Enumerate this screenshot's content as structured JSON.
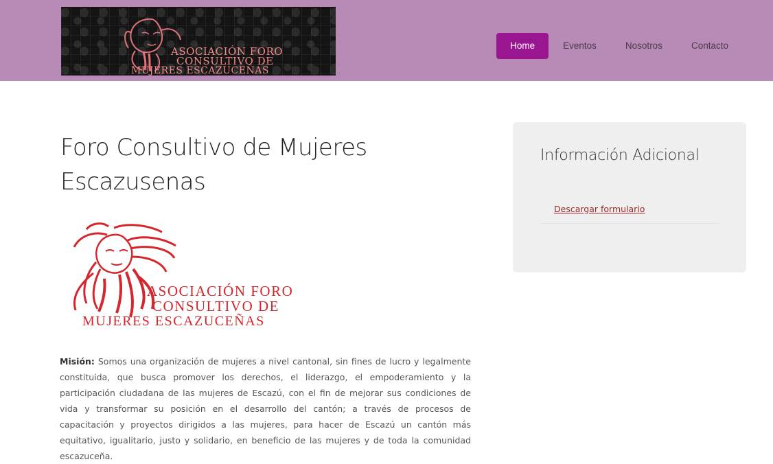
{
  "header": {
    "banner_line1": "ASOCIACIÓN FORO",
    "banner_line2": "CONSULTIVO DE",
    "banner_line3": "MUJERES ESCAZUCEÑAS"
  },
  "nav": {
    "items": [
      {
        "label": "Home",
        "active": true
      },
      {
        "label": "Eventos"
      },
      {
        "label": "Nosotros"
      },
      {
        "label": "Contacto"
      }
    ]
  },
  "main": {
    "title": "Foro Consultivo de Mujeres Escazusenas",
    "logo_line1": "ASOCIACIÓN FORO",
    "logo_line2": "CONSULTIVO DE",
    "logo_line3": "MUJERES ESCAZUCEÑAS",
    "mision_label": "Misión:",
    "mision_text": " Somos una organización de mujeres a nivel cantonal, sin fines de lucro y legalmente constituida, que busca promover los derechos, el liderazgo, el empoderamiento y la participación ciudadana de las mujeres de Escazú, con el fin de mejorar sus condiciones de vida y transformar su posición en el desarrollo del cantón; a través de procesos de capacitación y proyectos dirigidos a las mujeres, para hacer de Escazú un cantón más equitativo, igualitario, justo y solidario, en beneficio de las mujeres y de toda la comunidad escazuceña."
  },
  "sidebar": {
    "title": "Información Adicional",
    "link": "Descargar formulario"
  },
  "colors": {
    "header_bg": "#b78bb6",
    "nav_active": "#9a1690",
    "logo_red": "#d4262c",
    "sidebar_bg": "#efefef"
  }
}
